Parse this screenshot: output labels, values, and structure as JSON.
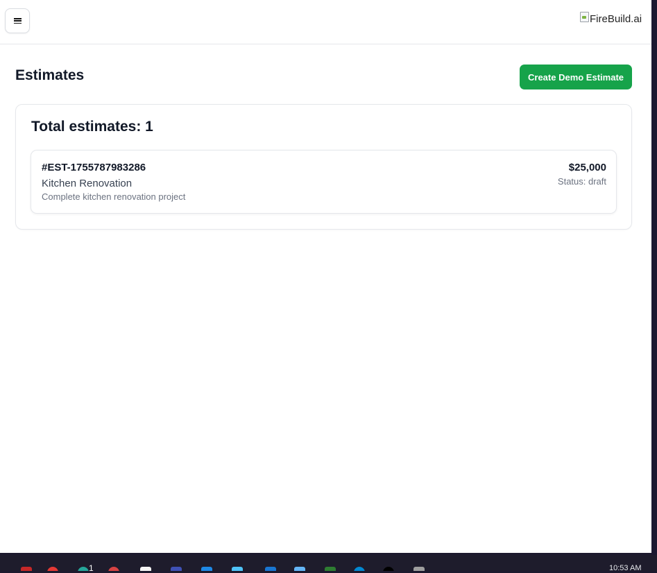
{
  "header": {
    "menu_icon": "hamburger-icon",
    "logo_alt": "FireBuild.ai"
  },
  "main": {
    "title": "Estimates",
    "create_button": "Create Demo Estimate",
    "accent_color": "#16a34a"
  },
  "summary": {
    "total_label": "Total estimates: 1"
  },
  "estimates": [
    {
      "id": "#EST-1755787983286",
      "title": "Kitchen Renovation",
      "description": "Complete kitchen renovation project",
      "amount": "$25,000",
      "status": "Status: draft"
    }
  ],
  "taskbar": {
    "badge": "1",
    "clock": "10:53 AM"
  }
}
